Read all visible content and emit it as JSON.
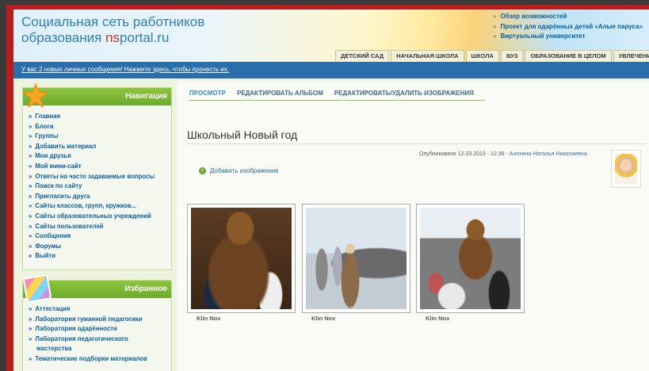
{
  "header": {
    "title_line1": "Социальная сеть работников",
    "title_line2_pre": "образования ",
    "title_line2_ns": "ns",
    "title_line2_rest": "portal.ru",
    "top_links": [
      "Обзор возможностей",
      "Проект для одарённых детей «Алые паруса»",
      "Виртуальный университет"
    ],
    "tabs": [
      "ДЕТСКИЙ САД",
      "НАЧАЛЬНАЯ ШКОЛА",
      "ШКОЛА",
      "ВУЗ",
      "ОБРАЗОВАНИЕ В ЦЕЛОМ",
      "УВЛЕЧЕНИЯ"
    ]
  },
  "message_bar": {
    "text": "У вас 2 новых личных сообщения! Нажмите здесь, чтобы прочесть их."
  },
  "nav_panel": {
    "title": "Навигация",
    "items": [
      "Главная",
      "Блоги",
      "Группы",
      "Добавить материал",
      "Мои друзья",
      "Мой мини-сайт",
      "Ответы на часто задаваемые вопросы",
      "Поиск по сайту",
      "Пригласить друга",
      "Сайты классов, групп, кружков...",
      "Сайты образовательных учреждений",
      "Сайты пользователей",
      "Сообщения",
      "Форумы",
      "Выйти"
    ]
  },
  "fav_panel": {
    "title": "Избранное",
    "items": [
      "Аттестация",
      "Лаборатория гуманной педагогики",
      "Лаборатория одарённости",
      "Лаборатория педагогического",
      "мастерства",
      "Тематические подборки материалов"
    ]
  },
  "album": {
    "tabs": [
      "ПРОСМОТР",
      "РЕДАКТИРОВАТЬ АЛЬБОМ",
      "РЕДАКТИРОВАТЬ/УДАЛИТЬ ИЗОБРАЖЕНИЯ"
    ],
    "title": "Школьный Новый год",
    "published_prefix": "Опубликовано 12.03.2013 - 12:36 - ",
    "author": "Анохина Наталья Николаевна",
    "add_image": "Добавить изображение",
    "thumbs": [
      {
        "caption": "Klin Nov"
      },
      {
        "caption": "Klin Nov"
      },
      {
        "caption": "Klin Nov"
      }
    ]
  },
  "colors": {
    "frame": "#b81c1c",
    "message_bar": "#2a6fab",
    "panel_head": "#8cc63f",
    "link": "#0b5fa0"
  }
}
